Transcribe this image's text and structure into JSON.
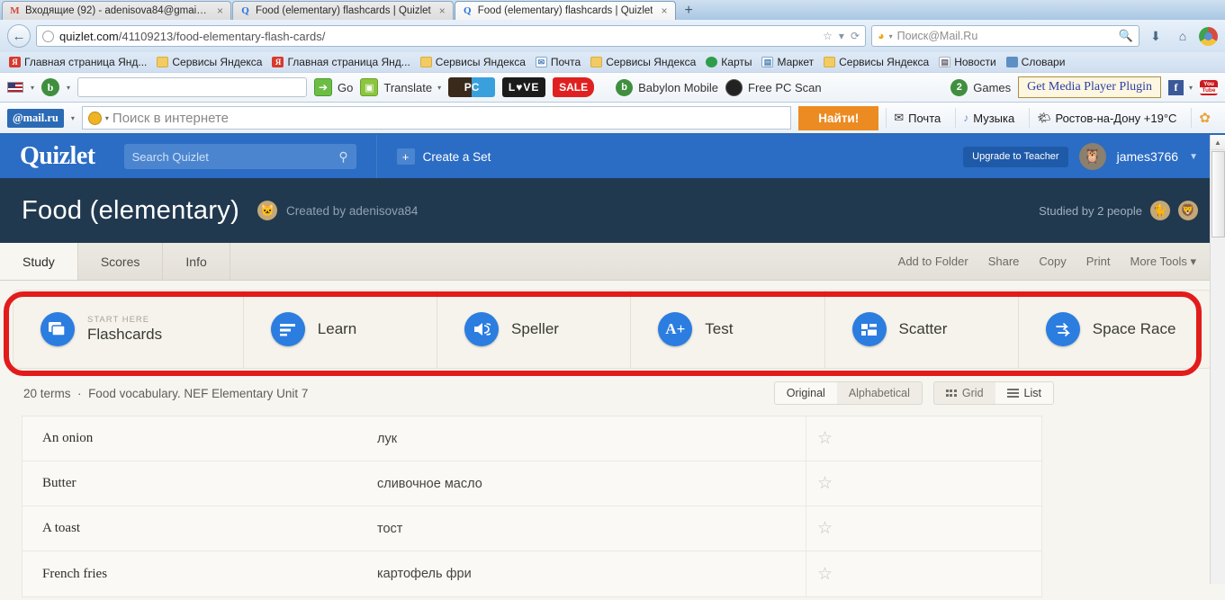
{
  "browser": {
    "tabs": [
      {
        "title": "Входящие (92) - adenisova84@gmail....",
        "favicon": "gmail-icon",
        "active": false
      },
      {
        "title": "Food (elementary) flashcards | Quizlet",
        "favicon": "quizlet-icon",
        "active": false
      },
      {
        "title": "Food (elementary) flashcards | Quizlet",
        "favicon": "quizlet-icon",
        "active": true
      }
    ],
    "new_tab_label": "+",
    "close_label": "×",
    "back_icon": "back-arrow-icon",
    "url_domain": "quizlet.com",
    "url_path": "/41109213/food-elementary-flash-cards/",
    "url_star_icon": "star-icon",
    "url_caret_icon": "chevron-down-icon",
    "url_reload_icon": "reload-icon",
    "search_placeholder": "Поиск@Mail.Ru",
    "search_engine_caret": "chevron-down-icon",
    "download_icon": "download-icon",
    "home_icon": "home-icon",
    "menu_icon": "chrome-menu-icon",
    "bookmarks": [
      {
        "label": "Главная страница Янд...",
        "icon": "yandex-icon"
      },
      {
        "label": "Сервисы Яндекса",
        "icon": "folder-icon"
      },
      {
        "label": "Главная страница Янд...",
        "icon": "yandex-icon"
      },
      {
        "label": "Сервисы Яндекса",
        "icon": "folder-icon"
      },
      {
        "label": "Почта",
        "icon": "mail-icon"
      },
      {
        "label": "Сервисы Яндекса",
        "icon": "folder-icon"
      },
      {
        "label": "Карты",
        "icon": "maps-icon"
      },
      {
        "label": "Маркет",
        "icon": "market-icon"
      },
      {
        "label": "Сервисы Яндекса",
        "icon": "folder-icon"
      },
      {
        "label": "Новости",
        "icon": "news-icon"
      },
      {
        "label": "Словари",
        "icon": "dictionary-icon"
      }
    ]
  },
  "babylon_toolbar": {
    "flag_icon": "us-flag-icon",
    "logo_icon": "babylon-logo-icon",
    "input_value": "",
    "go_label": "Go",
    "translate_label": "Translate",
    "translate_caret": "chevron-down-icon",
    "ad_pc": "PC",
    "ad_love": "L♥VE",
    "ad_sale": "SALE",
    "babylon_mobile": "Babylon Mobile",
    "free_pc_scan": "Free PC Scan",
    "games": "Games",
    "media_plugin": "Get Media Player Plugin",
    "facebook_icon": "facebook-icon",
    "youtube_icon": "youtube-icon"
  },
  "mailru_toolbar": {
    "logo": "@mail.ru",
    "search_placeholder": "Поиск в интернете",
    "search_value": "",
    "find_button": "Найти!",
    "links": [
      {
        "label": "Почта",
        "icon": "envelope-icon"
      },
      {
        "label": "Музыка",
        "icon": "music-note-icon"
      },
      {
        "label": "Ростов-на-Дону +19°C",
        "icon": "weather-icon"
      }
    ],
    "settings_icon": "gear-icon"
  },
  "quizlet": {
    "logo": "Quizlet",
    "search_placeholder": "Search Quizlet",
    "search_icon": "search-icon",
    "create_set": "Create a Set",
    "create_icon": "plus-square-icon",
    "upgrade": "Upgrade to Teacher",
    "username": "james3766",
    "user_caret": "chevron-down-icon",
    "set_title": "Food (elementary)",
    "created_by": "Created by adenisova84",
    "studied_by": "Studied by 2 people",
    "tabs": [
      {
        "label": "Study",
        "active": true
      },
      {
        "label": "Scores",
        "active": false
      },
      {
        "label": "Info",
        "active": false
      }
    ],
    "tools": [
      {
        "label": "Add to Folder"
      },
      {
        "label": "Share"
      },
      {
        "label": "Copy"
      },
      {
        "label": "Print"
      },
      {
        "label": "More Tools",
        "caret": "chevron-down-icon"
      }
    ],
    "start_here": "START HERE",
    "modes": [
      {
        "label": "Flashcards",
        "icon": "cards-icon"
      },
      {
        "label": "Learn",
        "icon": "list-lines-icon"
      },
      {
        "label": "Speller",
        "icon": "speaker-icon"
      },
      {
        "label": "Test",
        "icon": "a-plus-icon"
      },
      {
        "label": "Scatter",
        "icon": "blocks-icon"
      },
      {
        "label": "Space Race",
        "icon": "arrows-icon"
      }
    ],
    "highlight_color": "#e21b1b",
    "accent_color": "#2b7de0",
    "terms_count": "20 terms",
    "terms_desc": "Food vocabulary. NEF Elementary Unit 7",
    "sort_options": [
      {
        "label": "Original",
        "active": true
      },
      {
        "label": "Alphabetical",
        "active": false
      }
    ],
    "view_options": [
      {
        "label": "Grid",
        "active": false,
        "icon": "grid-icon"
      },
      {
        "label": "List",
        "active": true,
        "icon": "list-icon"
      }
    ],
    "star_icon": "star-outline-icon",
    "terms": [
      {
        "term": "An onion",
        "definition": "лук"
      },
      {
        "term": "Butter",
        "definition": "сливочное масло"
      },
      {
        "term": "A toast",
        "definition": "тост"
      },
      {
        "term": "French fries",
        "definition": "картофель фри"
      }
    ]
  }
}
